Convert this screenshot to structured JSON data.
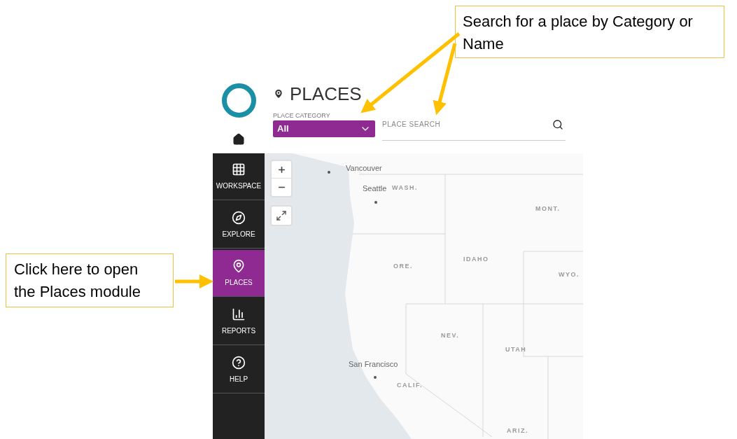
{
  "callouts": [
    {
      "text": "Search for a place by Category or Name"
    },
    {
      "text": "Click here to open the Places module"
    }
  ],
  "header": {
    "title": "PLACES",
    "category": {
      "label": "PLACE CATEGORY",
      "value": "All"
    },
    "search": {
      "placeholder": "PLACE SEARCH"
    }
  },
  "sidebar": {
    "items": [
      {
        "label": "WORKSPACE",
        "kind": "grid",
        "selected": false
      },
      {
        "label": "EXPLORE",
        "kind": "compass",
        "selected": false
      },
      {
        "label": "PLACES",
        "kind": "pin",
        "selected": true
      },
      {
        "label": "REPORTS",
        "kind": "chart",
        "selected": false
      },
      {
        "label": "HELP",
        "kind": "help",
        "selected": false
      }
    ]
  },
  "map": {
    "labels": [
      {
        "text": "Vancouver",
        "kind": "city"
      },
      {
        "text": "Seattle",
        "kind": "city"
      },
      {
        "text": "WASH.",
        "kind": "state"
      },
      {
        "text": "MONT.",
        "kind": "state"
      },
      {
        "text": "ORE.",
        "kind": "state"
      },
      {
        "text": "IDAHO",
        "kind": "state"
      },
      {
        "text": "WYO.",
        "kind": "state"
      },
      {
        "text": "NEV.",
        "kind": "state"
      },
      {
        "text": "UTAH",
        "kind": "state"
      },
      {
        "text": "San Francisco",
        "kind": "city"
      },
      {
        "text": "CALIF.",
        "kind": "state"
      },
      {
        "text": "ARIZ.",
        "kind": "state"
      }
    ]
  }
}
